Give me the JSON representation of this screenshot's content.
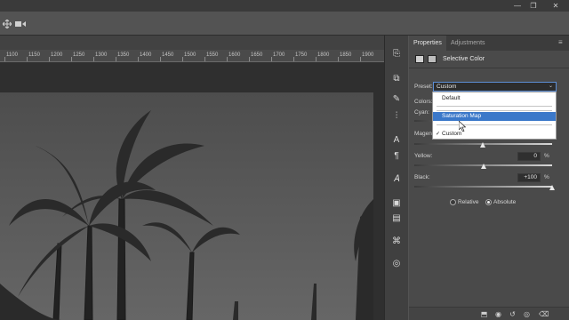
{
  "window": {
    "minimize_glyph": "—",
    "restore_glyph": "❐",
    "close_glyph": "✕"
  },
  "options_bar": {
    "icons": [
      "move-3d-icon",
      "video-camera-icon"
    ]
  },
  "ruler": {
    "labels": [
      "1100",
      "1150",
      "1200",
      "1250",
      "1300",
      "1350",
      "1400",
      "1450",
      "1500",
      "1550",
      "1600",
      "1650",
      "1700",
      "1750",
      "1800",
      "1850",
      "1900"
    ]
  },
  "panel": {
    "tabs": {
      "properties": "Properties",
      "adjustments": "Adjustments"
    },
    "menu_glyph": "≡",
    "title": "Selective Color",
    "preset": {
      "label": "Preset:",
      "value": "Custom",
      "options": [
        {
          "label": "Default",
          "checked": false,
          "highlighted": false
        },
        {
          "label": "Saturation Map",
          "checked": false,
          "highlighted": true
        },
        {
          "label": "Custom",
          "checked": true,
          "highlighted": false
        }
      ],
      "check_glyph": "✓"
    },
    "colors_label": "Colors:",
    "sliders": {
      "cyan": {
        "label": "Cyan:"
      },
      "magenta": {
        "label": "Magen"
      },
      "yellow": {
        "label": "Yellow:",
        "value": "0",
        "unit": "%",
        "level": 0.5
      },
      "black": {
        "label": "Black:",
        "value": "+100",
        "unit": "%",
        "level": 1.0
      }
    },
    "method": {
      "relative": "Relative",
      "absolute": "Absolute",
      "selected": "absolute"
    }
  },
  "colors": {
    "accent": "#3b78c9",
    "panel_bg": "#4a4a4a"
  }
}
